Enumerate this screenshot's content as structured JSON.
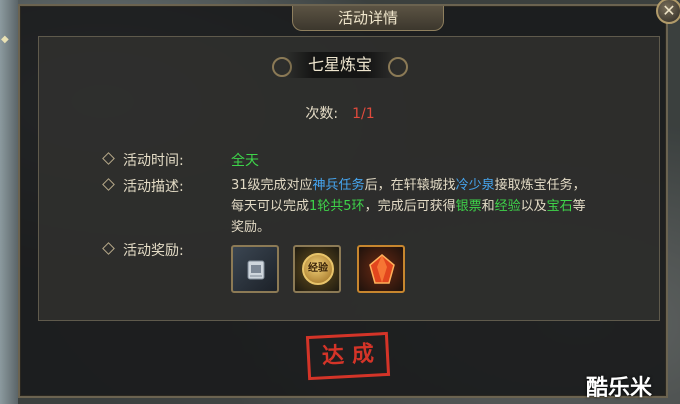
{
  "window": {
    "title": "活动详情",
    "close_icon": "close-icon"
  },
  "activity": {
    "name": "七星炼宝",
    "count_label": "次数:",
    "count_value": "1/1",
    "time_label": "活动时间:",
    "time_value": "全天",
    "desc_label": "活动描述:",
    "desc_parts": {
      "p1": "31级完成对应",
      "p2": "神兵任务",
      "p3": "后，在轩辕城找",
      "p4": "冷少泉",
      "p5": "接取炼宝任务，每天可以完成",
      "p6": "1轮共5环",
      "p7": "，完成后可获得",
      "p8": "银票",
      "p9": "和",
      "p10": "经验",
      "p11": "以及",
      "p12": "宝石",
      "p13": "等奖励。"
    },
    "reward_label": "活动奖励:",
    "rewards": [
      {
        "icon": "silver-note-scroll-icon"
      },
      {
        "icon": "experience-medal-icon",
        "text": "经验"
      },
      {
        "icon": "red-gem-icon"
      }
    ]
  },
  "stamp": "达成",
  "watermark": "酷乐米",
  "colors": {
    "highlight_blue": "#46a6f0",
    "highlight_green": "#3ed44a",
    "count_red": "#e04a3c",
    "stamp_red": "#d43428"
  }
}
